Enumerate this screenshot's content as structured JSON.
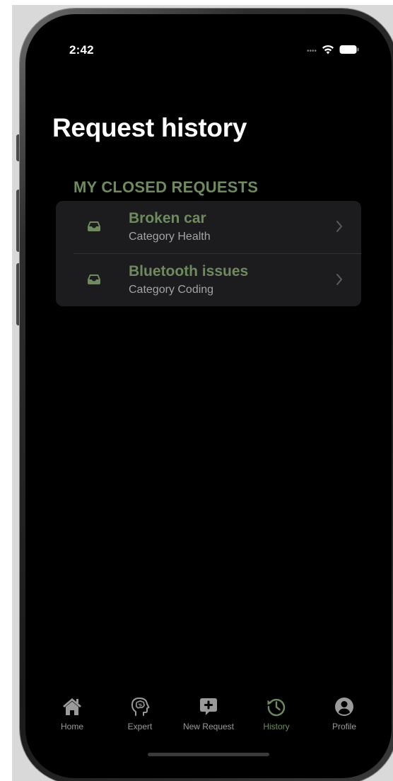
{
  "status_bar": {
    "time": "2:42",
    "signal_icon": "cellular-dots-icon",
    "wifi_icon": "wifi-icon",
    "battery_icon": "battery-icon"
  },
  "page": {
    "title": "Request history"
  },
  "section": {
    "header": "MY CLOSED REQUESTS"
  },
  "requests": [
    {
      "title": "Broken car",
      "subtitle": "Category Health",
      "icon": "tray-icon"
    },
    {
      "title": "Bluetooth issues",
      "subtitle": "Category Coding",
      "icon": "tray-icon"
    }
  ],
  "tab_bar": {
    "tabs": [
      {
        "label": "Home",
        "icon": "house-icon",
        "active": false
      },
      {
        "label": "Expert",
        "icon": "brain-head-icon",
        "active": false
      },
      {
        "label": "New Request",
        "icon": "plus-bubble-icon",
        "active": false
      },
      {
        "label": "History",
        "icon": "clock-history-icon",
        "active": true
      },
      {
        "label": "Profile",
        "icon": "person-circle-icon",
        "active": false
      }
    ]
  },
  "colors": {
    "accent": "#6f8a5e",
    "background": "#000000",
    "card": "#1c1c1e",
    "secondary_text": "#a3a3a8",
    "inactive_tab": "#9a9a9a"
  }
}
